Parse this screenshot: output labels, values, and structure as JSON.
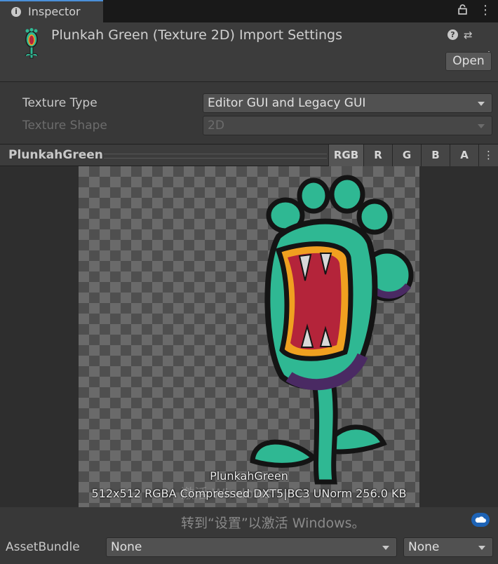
{
  "tab": {
    "label": "Inspector",
    "icon": "info-icon"
  },
  "header": {
    "title": "Plunkah Green (Texture 2D) Import Settings",
    "open_label": "Open"
  },
  "settings": {
    "texture_type": {
      "label": "Texture Type",
      "value": "Editor GUI and Legacy GUI"
    },
    "texture_shape": {
      "label": "Texture Shape",
      "value": "2D"
    }
  },
  "preview": {
    "name": "PlunkahGreen",
    "channels": [
      "RGB",
      "R",
      "G",
      "B",
      "A"
    ],
    "caption_name": "PlunkahGreen",
    "caption_info": "512x512  RGBA Compressed DXT5|BC3 UNorm   256.0 KB",
    "overlay_text": "激活 Windows"
  },
  "footer": {
    "activation_text": "转到“设置”以激活 Windows。",
    "assetbundle_label": "AssetBundle",
    "bundle_name": "None",
    "bundle_variant": "None"
  },
  "colors": {
    "plant_green": "#2fb893",
    "plant_dark": "#4a2a63",
    "mouth_red": "#b4243a",
    "lip_orange": "#f0a020",
    "accent_blue": "#4a90d9"
  }
}
